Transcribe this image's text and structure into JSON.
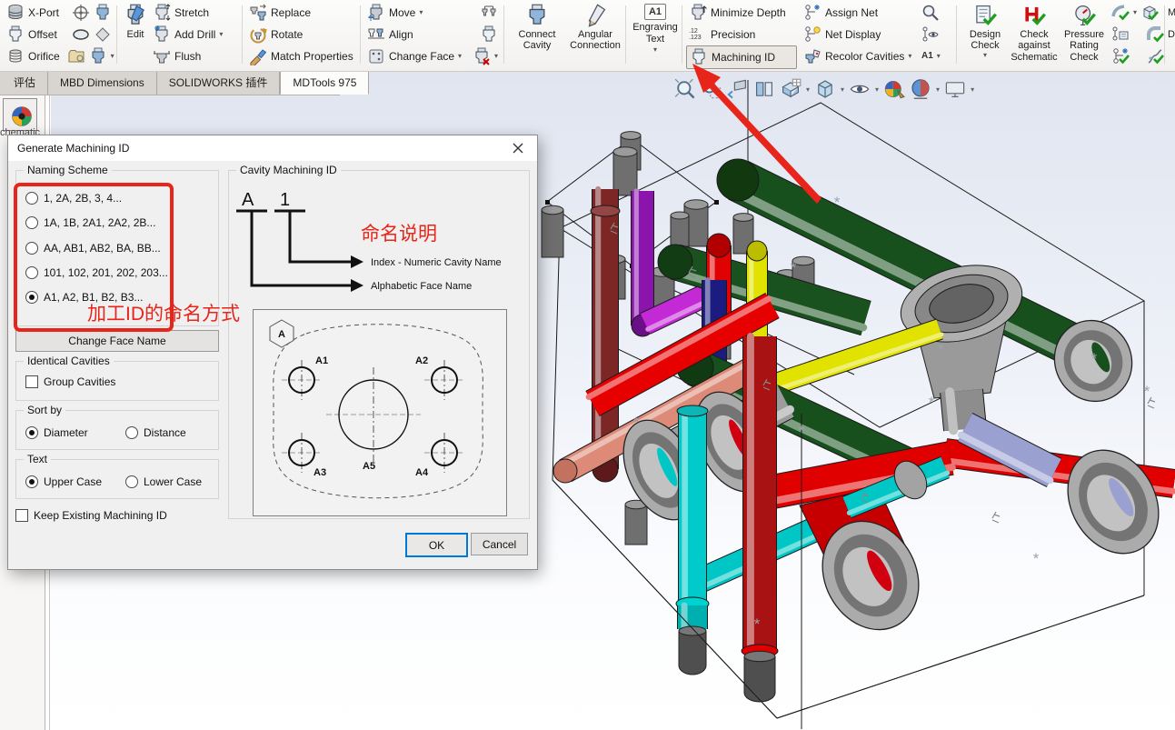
{
  "ribbon": {
    "g1": {
      "rows": [
        {
          "label": "X-Port"
        },
        {
          "label": "Offset"
        },
        {
          "label": "Orifice"
        }
      ]
    },
    "g2": {
      "edit": "Edit",
      "rows": [
        {
          "label": "Stretch"
        },
        {
          "label": "Add Drill"
        },
        {
          "label": "Flush"
        }
      ]
    },
    "g3": {
      "rows": [
        {
          "label": "Replace"
        },
        {
          "label": "Rotate"
        },
        {
          "label": "Match Properties"
        }
      ]
    },
    "g4": {
      "rows": [
        {
          "label": "Move"
        },
        {
          "label": "Align"
        },
        {
          "label": "Change Face"
        }
      ]
    },
    "g5": [
      {
        "label": "Connect Cavity"
      },
      {
        "label": "Angular Connection"
      }
    ],
    "g6": {
      "label": "Engraving Text",
      "glyph": "A1"
    },
    "g7": {
      "col1": [
        {
          "label": "Minimize Depth"
        },
        {
          "label": "Precision"
        },
        {
          "label": "Machining ID",
          "active": true
        }
      ],
      "col2": [
        {
          "label": "Assign Net"
        },
        {
          "label": "Net Display"
        },
        {
          "label": "Recolor Cavities"
        }
      ],
      "glyphs": {
        "precision_top": ".12",
        "precision_bot": ".123",
        "machid": "1·2·3",
        "a1": "A1"
      }
    },
    "g8": [
      {
        "label": "Design Check"
      },
      {
        "label": "Check against Schematic"
      },
      {
        "label": "Pressure Rating Check"
      }
    ],
    "g9": {
      "trunc1": "M",
      "trunc2": "D"
    }
  },
  "tabs": {
    "items": [
      {
        "label": "评估"
      },
      {
        "label": "MBD Dimensions"
      },
      {
        "label": "SOLIDWORKS 插件"
      },
      {
        "label": "MDTools 975",
        "active": true
      }
    ]
  },
  "left_panel": {
    "tab": "chematic"
  },
  "dialog": {
    "title": "Generate Machining ID",
    "naming": {
      "label": "Naming Scheme",
      "options": [
        {
          "label": "1, 2A, 2B, 3, 4...",
          "sel": false
        },
        {
          "label": "1A, 1B, 2A1, 2A2, 2B...",
          "sel": false
        },
        {
          "label": "AA, AB1, AB2, BA, BB...",
          "sel": false
        },
        {
          "label": "101, 102, 201, 202, 203...",
          "sel": false
        },
        {
          "label": "A1, A2, B1, B2, B3...",
          "sel": true
        }
      ]
    },
    "change_face": "Change Face Name",
    "identical": {
      "label": "Identical Cavities",
      "option": "Group Cavities",
      "checked": false
    },
    "sort": {
      "label": "Sort by",
      "options": [
        {
          "label": "Diameter",
          "sel": true
        },
        {
          "label": "Distance",
          "sel": false
        }
      ]
    },
    "text": {
      "label": "Text",
      "options": [
        {
          "label": "Upper Case",
          "sel": true
        },
        {
          "label": "Lower Case",
          "sel": false
        }
      ]
    },
    "keep": {
      "label": "Keep Existing Machining ID",
      "checked": false
    },
    "cavity": {
      "label": "Cavity Machining ID",
      "letter": "A",
      "digit": "1",
      "index_note": "Index - Numeric Cavity Name",
      "face_note": "Alphabetic Face Name"
    },
    "diagram": {
      "face": "A",
      "h1": "A1",
      "h2": "A2",
      "h3": "A3",
      "h4": "A4",
      "h5": "A5"
    },
    "ok": "OK",
    "cancel": "Cancel"
  },
  "annotations": {
    "naming_note": "命名说明",
    "scheme_note": "加工ID的命名方式",
    "color": "#e8251a"
  },
  "palette": {
    "accent_blue": "#0078d7",
    "annotation_red": "#e8251a",
    "pipe_red": "#e00000",
    "pipe_dark_red": "#a81212",
    "pipe_maroon": "#7c2626",
    "pipe_green": "#174f1d",
    "pipe_magenta": "#c32ad6",
    "pipe_purple": "#8a14ac",
    "pipe_yellow": "#e2e200",
    "pipe_cyan": "#00c6c6",
    "pipe_navy": "#1c1c80",
    "pipe_salmon": "#dd8a78",
    "pipe_lavender": "#9aa0cf",
    "steel_gray": "#a8a8a8"
  }
}
